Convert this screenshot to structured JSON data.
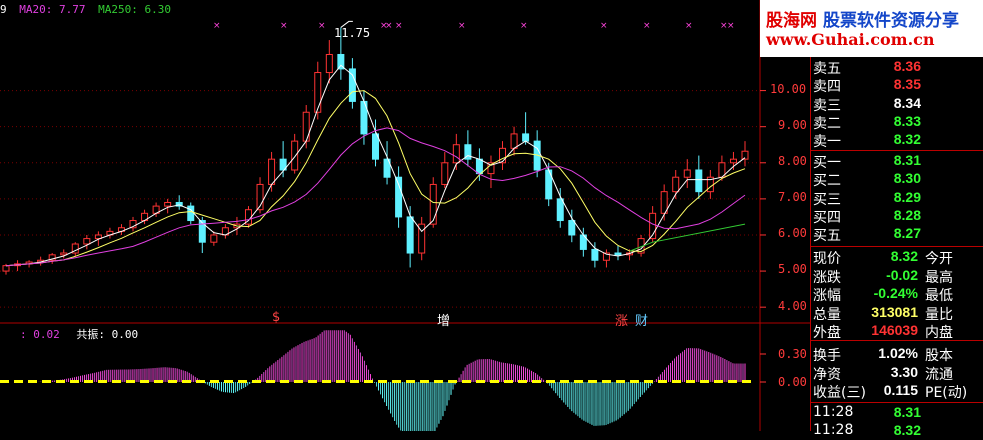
{
  "colors": {
    "up": "#ff3333",
    "down": "#5ff0ff",
    "ma5": "#ffffff",
    "ma10": "#ffff66",
    "ma20": "#e040e0",
    "ma250": "#33cc33",
    "grid": "#7a0000",
    "pink": "#ff44dd",
    "cyan": "#66ffff",
    "yellow": "#ffff00"
  },
  "legend": {
    "ma_first": "9",
    "ma20": "MA20: 7.77",
    "ma250": "MA250: 6.30"
  },
  "indicator": {
    "value": ": 0.02",
    "label": "共振: 0.00"
  },
  "high_marker": "11.75",
  "y_ticks": [
    "10.00",
    "9.00",
    "8.00",
    "7.00",
    "6.00",
    "5.00",
    "4.00"
  ],
  "ind_ticks": [
    "0.30",
    "0.00"
  ],
  "signals": [
    {
      "text": "$",
      "color": "#ff4444"
    },
    {
      "text": "增",
      "color": "#ffffff"
    },
    {
      "text": "涨",
      "color": "#ff4444"
    },
    {
      "text": "财",
      "color": "#66ccff"
    }
  ],
  "banner": {
    "line1a": "股海网",
    "line1b": "股票软件资源分享",
    "line2": "www.Guhai.com.cn"
  },
  "order_book": {
    "sell": [
      {
        "label": "卖五",
        "price": "8.36"
      },
      {
        "label": "卖四",
        "price": "8.35"
      },
      {
        "label": "卖三",
        "price": "8.34"
      },
      {
        "label": "卖二",
        "price": "8.33"
      },
      {
        "label": "卖一",
        "price": "8.32"
      }
    ],
    "buy": [
      {
        "label": "买一",
        "price": "8.31"
      },
      {
        "label": "买二",
        "price": "8.30"
      },
      {
        "label": "买三",
        "price": "8.29"
      },
      {
        "label": "买四",
        "price": "8.28"
      },
      {
        "label": "买五",
        "price": "8.27"
      }
    ]
  },
  "stats": [
    {
      "label": "现价",
      "value": "8.32",
      "label2": "今开"
    },
    {
      "label": "涨跌",
      "value": "-0.02",
      "label2": "最高"
    },
    {
      "label": "涨幅",
      "value": "-0.24%",
      "label2": "最低"
    },
    {
      "label": "总量",
      "value": "313081",
      "label2": "量比"
    },
    {
      "label": "外盘",
      "value": "146039",
      "label2": "内盘"
    },
    {
      "label": "换手",
      "value": "1.02%",
      "label2": "股本"
    },
    {
      "label": "净资",
      "value": "3.30",
      "label2": "流通"
    },
    {
      "label": "收益(三)",
      "value": "0.115",
      "label2": "PE(动)"
    }
  ],
  "ticks": [
    {
      "time": "11:28",
      "price": "8.31"
    },
    {
      "time": "11:28",
      "price": "8.32"
    }
  ],
  "chart_data": {
    "type": "candlestick",
    "y_range": [
      3.7,
      11.9
    ],
    "ohlc_approx": [
      [
        5.0,
        5.2,
        4.9,
        5.15
      ],
      [
        5.15,
        5.3,
        5.0,
        5.2
      ],
      [
        5.2,
        5.3,
        5.1,
        5.25
      ],
      [
        5.25,
        5.4,
        5.15,
        5.3
      ],
      [
        5.3,
        5.5,
        5.2,
        5.45
      ],
      [
        5.45,
        5.6,
        5.35,
        5.5
      ],
      [
        5.5,
        5.8,
        5.4,
        5.75
      ],
      [
        5.75,
        6.0,
        5.6,
        5.9
      ],
      [
        5.9,
        6.1,
        5.7,
        6.0
      ],
      [
        6.0,
        6.2,
        5.9,
        6.1
      ],
      [
        6.1,
        6.3,
        6.0,
        6.2
      ],
      [
        6.2,
        6.5,
        6.1,
        6.4
      ],
      [
        6.4,
        6.7,
        6.3,
        6.6
      ],
      [
        6.6,
        6.9,
        6.5,
        6.8
      ],
      [
        6.8,
        7.0,
        6.6,
        6.9
      ],
      [
        6.9,
        7.1,
        6.7,
        6.8
      ],
      [
        6.8,
        6.9,
        6.3,
        6.4
      ],
      [
        6.4,
        6.5,
        5.5,
        5.8
      ],
      [
        5.8,
        6.1,
        5.7,
        6.0
      ],
      [
        6.0,
        6.3,
        5.9,
        6.2
      ],
      [
        6.2,
        6.5,
        6.0,
        6.3
      ],
      [
        6.3,
        6.8,
        6.2,
        6.7
      ],
      [
        6.7,
        7.6,
        6.6,
        7.4
      ],
      [
        7.4,
        8.3,
        7.2,
        8.1
      ],
      [
        8.1,
        8.6,
        7.6,
        7.8
      ],
      [
        7.8,
        8.8,
        7.7,
        8.6
      ],
      [
        8.6,
        9.6,
        8.4,
        9.4
      ],
      [
        9.4,
        10.8,
        9.2,
        10.5
      ],
      [
        10.5,
        11.4,
        10.2,
        11.0
      ],
      [
        11.0,
        11.75,
        10.3,
        10.6
      ],
      [
        10.6,
        10.9,
        9.5,
        9.7
      ],
      [
        9.7,
        10.0,
        8.5,
        8.8
      ],
      [
        8.8,
        9.2,
        7.9,
        8.1
      ],
      [
        8.1,
        8.6,
        7.4,
        7.6
      ],
      [
        7.6,
        7.9,
        6.2,
        6.5
      ],
      [
        6.5,
        6.8,
        5.1,
        5.5
      ],
      [
        5.5,
        6.5,
        5.3,
        6.3
      ],
      [
        6.3,
        7.6,
        6.2,
        7.4
      ],
      [
        7.4,
        8.3,
        7.3,
        8.0
      ],
      [
        8.0,
        8.8,
        7.8,
        8.5
      ],
      [
        8.5,
        8.9,
        7.9,
        8.1
      ],
      [
        8.1,
        8.4,
        7.5,
        7.7
      ],
      [
        7.7,
        8.2,
        7.3,
        8.0
      ],
      [
        8.0,
        8.6,
        7.8,
        8.4
      ],
      [
        8.4,
        9.0,
        8.2,
        8.8
      ],
      [
        8.8,
        9.4,
        8.5,
        8.6
      ],
      [
        8.6,
        8.9,
        7.6,
        7.8
      ],
      [
        7.8,
        8.0,
        6.8,
        7.0
      ],
      [
        7.0,
        7.3,
        6.2,
        6.4
      ],
      [
        6.4,
        6.7,
        5.8,
        6.0
      ],
      [
        6.0,
        6.2,
        5.4,
        5.6
      ],
      [
        5.6,
        5.8,
        5.1,
        5.3
      ],
      [
        5.3,
        5.6,
        5.1,
        5.5
      ],
      [
        5.5,
        5.7,
        5.3,
        5.45
      ],
      [
        5.45,
        5.6,
        5.3,
        5.5
      ],
      [
        5.5,
        6.0,
        5.4,
        5.9
      ],
      [
        5.9,
        6.8,
        5.8,
        6.6
      ],
      [
        6.6,
        7.4,
        6.4,
        7.2
      ],
      [
        7.2,
        7.8,
        7.0,
        7.6
      ],
      [
        7.6,
        8.1,
        7.3,
        7.8
      ],
      [
        7.8,
        8.2,
        7.0,
        7.2
      ],
      [
        7.2,
        7.8,
        7.0,
        7.6
      ],
      [
        7.6,
        8.2,
        7.5,
        8.0
      ],
      [
        8.0,
        8.3,
        7.8,
        8.1
      ],
      [
        8.1,
        8.6,
        7.9,
        8.32
      ]
    ]
  }
}
